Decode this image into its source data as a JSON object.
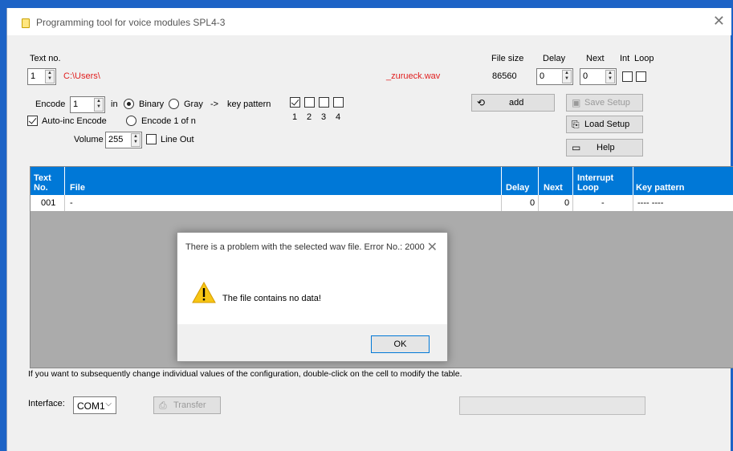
{
  "window": {
    "title": "Programming tool for voice modules SPL4-3"
  },
  "text_no": {
    "label": "Text no.",
    "value": "1",
    "path": "C:\\Users\\",
    "filename": "_zurueck.wav"
  },
  "file_size": {
    "label": "File size",
    "value": "86560"
  },
  "delay": {
    "label": "Delay",
    "value": "0"
  },
  "next": {
    "label": "Next",
    "value": "0"
  },
  "int_label": "Int",
  "loop_label": "Loop",
  "encode": {
    "label": "Encode",
    "value": "1",
    "in_label": "in",
    "binary_label": "Binary",
    "gray_label": "Gray",
    "arrow_label": "->",
    "key_pattern_label": "key pattern",
    "key_numbers": [
      "1",
      "2",
      "3",
      "4"
    ],
    "auto_inc_label": "Auto-inc Encode",
    "encode_1_of_n_label": "Encode 1 of n"
  },
  "volume": {
    "label": "Volume",
    "value": "255",
    "line_out_label": "Line Out"
  },
  "buttons": {
    "add": "add",
    "save_setup": "Save Setup",
    "load_setup": "Load Setup",
    "help": "Help",
    "transfer": "Transfer"
  },
  "table": {
    "headers": {
      "text_no": [
        "Text",
        "No."
      ],
      "file": "File",
      "delay": "Delay",
      "next": "Next",
      "interrupt_loop": [
        "Interrupt",
        "Loop"
      ],
      "key_pattern": "Key pattern"
    },
    "rows": [
      {
        "text_no": "001",
        "file": "-",
        "delay": "0",
        "next": "0",
        "interrupt_loop": "-",
        "key_pattern": "---- ----"
      }
    ]
  },
  "dialog": {
    "title": "There is a problem with the selected wav file. Error No.: 2000",
    "message": "The file contains no data!",
    "ok_label": "OK"
  },
  "hint": "If you want to subsequently change individual values of the configuration, double-click on the cell to modify the table.",
  "interface": {
    "label": "Interface:",
    "value": "COM1"
  },
  "colors": {
    "accent": "#0078d7",
    "path_text": "#e02020",
    "titlebar_accent": "#1d63c6"
  },
  "icons": {
    "app": "app-icon",
    "close": "close-icon",
    "add": "add-icon",
    "save": "save-icon",
    "load": "load-icon",
    "help": "help-icon",
    "transfer": "transfer-icon",
    "warning": "warning-icon"
  }
}
